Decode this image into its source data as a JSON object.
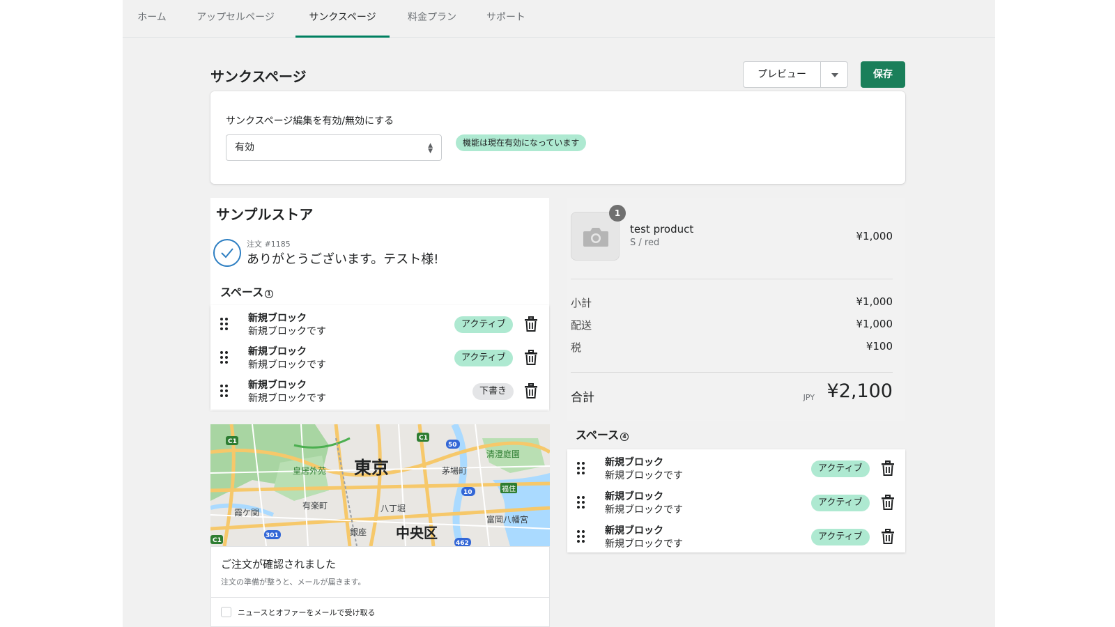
{
  "nav": {
    "tabs": [
      {
        "label": "ホーム",
        "active": false
      },
      {
        "label": "アップセルページ",
        "active": false
      },
      {
        "label": "サンクスページ",
        "active": true
      },
      {
        "label": "料金プラン",
        "active": false
      },
      {
        "label": "サポート",
        "active": false
      }
    ]
  },
  "header": {
    "title": "サンクスページ",
    "preview_label": "プレビュー",
    "save_label": "保存"
  },
  "settings": {
    "field_label": "サンクスページ編集を有効/無効にする",
    "select_value": "有効",
    "status_badge": "機能は現在有効になっています"
  },
  "preview_left": {
    "store_name": "サンプルストア",
    "order_number": "注文 #1185",
    "thanks_message": "ありがとうございます。テスト様!",
    "space_title": "スペース",
    "space_number": "1",
    "blocks": [
      {
        "title": "新規ブロック",
        "subtitle": "新規ブロックです",
        "status": "アクティブ"
      },
      {
        "title": "新規ブロック",
        "subtitle": "新規ブロックです",
        "status": "アクティブ"
      },
      {
        "title": "新規ブロック",
        "subtitle": "新規ブロックです",
        "status": "下書き"
      }
    ],
    "map": {
      "labels": [
        "東京",
        "中央区",
        "皇居外苑",
        "有楽町",
        "八丁堀",
        "茅場町",
        "霞ケ関",
        "銀座",
        "清澄庭園",
        "富岡八幡宮",
        "福住"
      ],
      "route_badges": [
        "C1",
        "C1",
        "C1",
        "50",
        "10",
        "301",
        "462"
      ]
    },
    "confirmation": {
      "title": "ご注文が確認されました",
      "subtitle": "注文の準備が整うと、メールが届きます。",
      "checkbox_label": "ニュースとオファーをメールで受け取る"
    }
  },
  "preview_right": {
    "product": {
      "name": "test product",
      "variant": "S / red",
      "price": "¥1,000",
      "quantity": "1"
    },
    "summary": [
      {
        "label": "小計",
        "value": "¥1,000"
      },
      {
        "label": "配送",
        "value": "¥1,000"
      },
      {
        "label": "税",
        "value": "¥100"
      }
    ],
    "total_label": "合計",
    "currency": "JPY",
    "total_value": "¥2,100",
    "space_title": "スペース",
    "space_number": "4",
    "blocks": [
      {
        "title": "新規ブロック",
        "subtitle": "新規ブロックです",
        "status": "アクティブ"
      },
      {
        "title": "新規ブロック",
        "subtitle": "新規ブロックです",
        "status": "アクティブ"
      },
      {
        "title": "新規ブロック",
        "subtitle": "新規ブロックです",
        "status": "アクティブ"
      }
    ]
  },
  "colors": {
    "primary": "#1a7f5a",
    "success_badge": "#aee9d1",
    "draft_badge": "#e4e5e7",
    "tab_underline": "#008060",
    "check_blue": "#2c7ec2"
  },
  "icons": [
    "drag-handle-icon",
    "trash-icon",
    "caret-down-icon",
    "checkmark-icon",
    "camera-icon",
    "info-icon",
    "select-arrows-icon"
  ]
}
